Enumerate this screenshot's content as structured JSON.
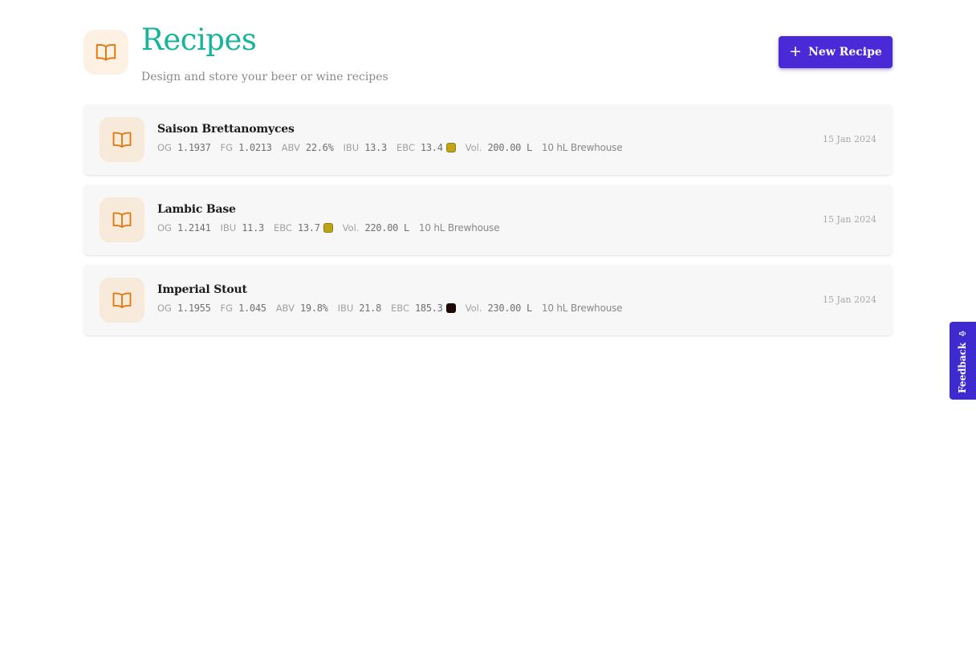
{
  "header": {
    "title": "Recipes",
    "subtitle": "Design and store your beer or wine recipes",
    "icon": "book-open-icon",
    "new_button_label": "New Recipe"
  },
  "colors": {
    "title": "#18b39b",
    "primary_button": "#4a2ad6",
    "icon_stroke": "#e07b12"
  },
  "recipes": [
    {
      "name": "Saison Brettanomyces",
      "date": "15 Jan 2024",
      "equipment": "10 hL Brewhouse",
      "stats": [
        {
          "label": "OG",
          "value": "1.1937"
        },
        {
          "label": "FG",
          "value": "1.0213"
        },
        {
          "label": "ABV",
          "value": "22.6%"
        },
        {
          "label": "IBU",
          "value": "13.3"
        },
        {
          "label": "EBC",
          "value": "13.4",
          "swatch": "#bfa718"
        },
        {
          "label": "Vol.",
          "value": "200.00 L"
        }
      ]
    },
    {
      "name": "Lambic Base",
      "date": "15 Jan 2024",
      "equipment": "10 hL Brewhouse",
      "stats": [
        {
          "label": "OG",
          "value": "1.2141"
        },
        {
          "label": "IBU",
          "value": "11.3"
        },
        {
          "label": "EBC",
          "value": "13.7",
          "swatch": "#bda416"
        },
        {
          "label": "Vol.",
          "value": "220.00 L"
        }
      ]
    },
    {
      "name": "Imperial Stout",
      "date": "15 Jan 2024",
      "equipment": "10 hL Brewhouse",
      "stats": [
        {
          "label": "OG",
          "value": "1.1955"
        },
        {
          "label": "FG",
          "value": "1.045"
        },
        {
          "label": "ABV",
          "value": "19.8%"
        },
        {
          "label": "IBU",
          "value": "21.8"
        },
        {
          "label": "EBC",
          "value": "185.3",
          "swatch": "#1e0704"
        },
        {
          "label": "Vol.",
          "value": "230.00 L"
        }
      ]
    }
  ],
  "feedback": {
    "label": "Feedback",
    "icon": "megaphone-icon"
  }
}
